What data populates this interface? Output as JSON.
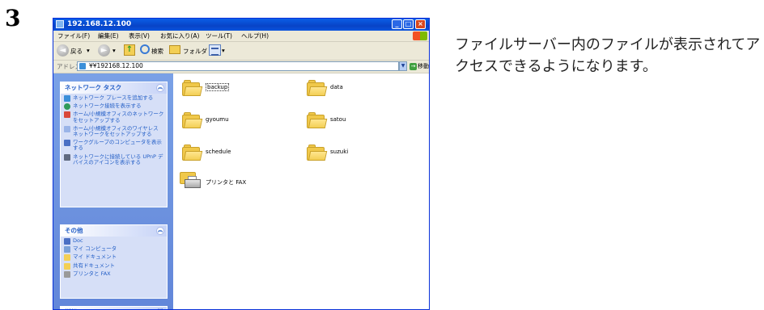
{
  "step_number": "3",
  "description": "ファイルサーバー内のファイルが表示されてアクセスできるようになります。",
  "window": {
    "title": "192.168.12.100",
    "menu": [
      "ファイル(F)",
      "編集(E)",
      "表示(V)",
      "お気に入り(A)",
      "ツール(T)",
      "ヘルプ(H)"
    ],
    "toolbar": {
      "back": "戻る",
      "search": "検索",
      "folders": "フォルダ"
    },
    "address": {
      "label": "アドレス(D)",
      "value": "¥¥192168.12.100",
      "go": "移動"
    }
  },
  "tasks_pane": {
    "network_tasks": {
      "title": "ネットワーク タスク",
      "items": [
        "ネットワーク プレースを追加する",
        "ネットワーク接続を表示する",
        "ホーム/小規模オフィスのネットワークをセットアップする",
        "ホーム/小規模オフィスのワイヤレス ネットワークをセットアップする",
        "ワークグループのコンピュータを表示する",
        "ネットワークに接続している UPnP デバイスのアイコンを表示する"
      ]
    },
    "other_places": {
      "title": "その他",
      "items": [
        "Doc",
        "マイ コンピュータ",
        "マイ ドキュメント",
        "共有ドキュメント",
        "プリンタと FAX"
      ]
    },
    "details": {
      "title": "詳細"
    }
  },
  "files": [
    {
      "name": "backup",
      "type": "folder"
    },
    {
      "name": "data",
      "type": "folder"
    },
    {
      "name": "gyoumu",
      "type": "folder"
    },
    {
      "name": "satou",
      "type": "folder"
    },
    {
      "name": "schedule",
      "type": "folder"
    },
    {
      "name": "suzuki",
      "type": "folder"
    },
    {
      "name": "プリンタと FAX",
      "type": "printers"
    }
  ],
  "colors": {
    "titlebar": "#0a5fe8",
    "task_pane": "#6f95e0",
    "task_link": "#215dc6",
    "folder": "#f3cf55"
  }
}
